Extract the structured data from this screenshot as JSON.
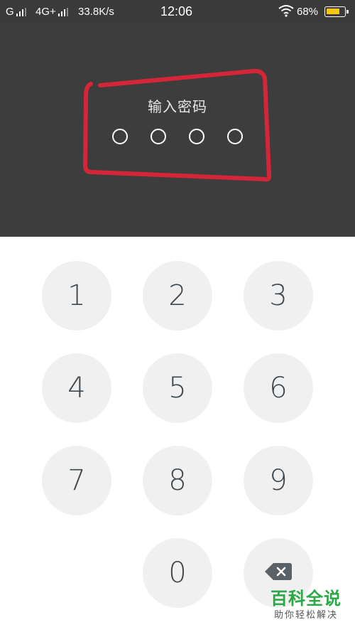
{
  "status_bar": {
    "carrier1": "G",
    "carrier2": "4G+",
    "speed": "33.8K/s",
    "time": "12:06",
    "battery": "68%",
    "battery_level": 0.68,
    "battery_color": "#f5c518",
    "icons": [
      "signal-icon",
      "wifi-icon",
      "battery-icon"
    ]
  },
  "lock": {
    "prompt": "输入密码",
    "pin_length": 4,
    "annotation_color": "#d42638"
  },
  "keypad": {
    "keys": [
      "1",
      "2",
      "3",
      "4",
      "5",
      "6",
      "7",
      "8",
      "9",
      "0"
    ],
    "backspace_icon": "backspace-icon"
  },
  "watermark": {
    "brand": "百科全说",
    "subtitle": "助你轻松解决"
  }
}
